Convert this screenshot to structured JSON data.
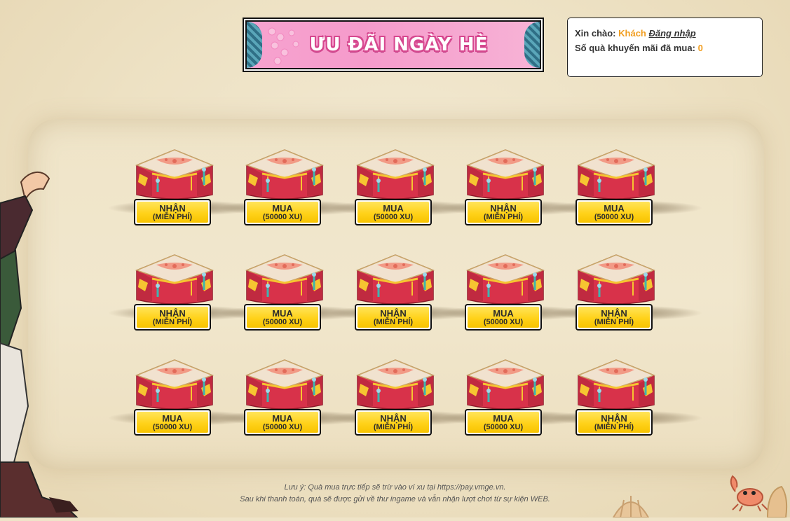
{
  "banner": {
    "title": "ƯU ĐÃI NGÀY HÈ"
  },
  "user": {
    "greeting_label": "Xin chào:",
    "guest_name": "Khách",
    "login_link": "Đăng nhập",
    "purchased_label": "Số quà khuyến mãi đã mua:",
    "purchased_count": "0"
  },
  "boxes": [
    {
      "main": "NHẬN",
      "sub": "(MIỄN PHÍ)"
    },
    {
      "main": "MUA",
      "sub": "(50000 XU)"
    },
    {
      "main": "MUA",
      "sub": "(50000 XU)"
    },
    {
      "main": "NHẬN",
      "sub": "(MIỄN PHÍ)"
    },
    {
      "main": "MUA",
      "sub": "(50000 XU)"
    },
    {
      "main": "NHẬN",
      "sub": "(MIỄN PHÍ)"
    },
    {
      "main": "MUA",
      "sub": "(50000 XU)"
    },
    {
      "main": "NHẬN",
      "sub": "(MIỄN PHÍ)"
    },
    {
      "main": "MUA",
      "sub": "(50000 XU)"
    },
    {
      "main": "NHẬN",
      "sub": "(MIỄN PHÍ)"
    },
    {
      "main": "MUA",
      "sub": "(50000 XU)"
    },
    {
      "main": "MUA",
      "sub": "(50000 XU)"
    },
    {
      "main": "NHẬN",
      "sub": "(MIỄN PHÍ)"
    },
    {
      "main": "MUA",
      "sub": "(50000 XU)"
    },
    {
      "main": "NHẬN",
      "sub": "(MIỄN PHÍ)"
    }
  ],
  "note": {
    "line1": "Lưu ý: Quà mua trực tiếp sẽ trừ vào ví xu tại https://pay.vmge.vn.",
    "line2": "Sau khi thanh toán, quà sẽ được gửi về thư ingame và vẫn nhận lượt chơi từ sự kiện WEB."
  },
  "colors": {
    "accent": "#f19d1e",
    "button_yellow": "#ffd21a",
    "chest_red": "#d8324a",
    "banner_pink": "#f59bcb"
  }
}
